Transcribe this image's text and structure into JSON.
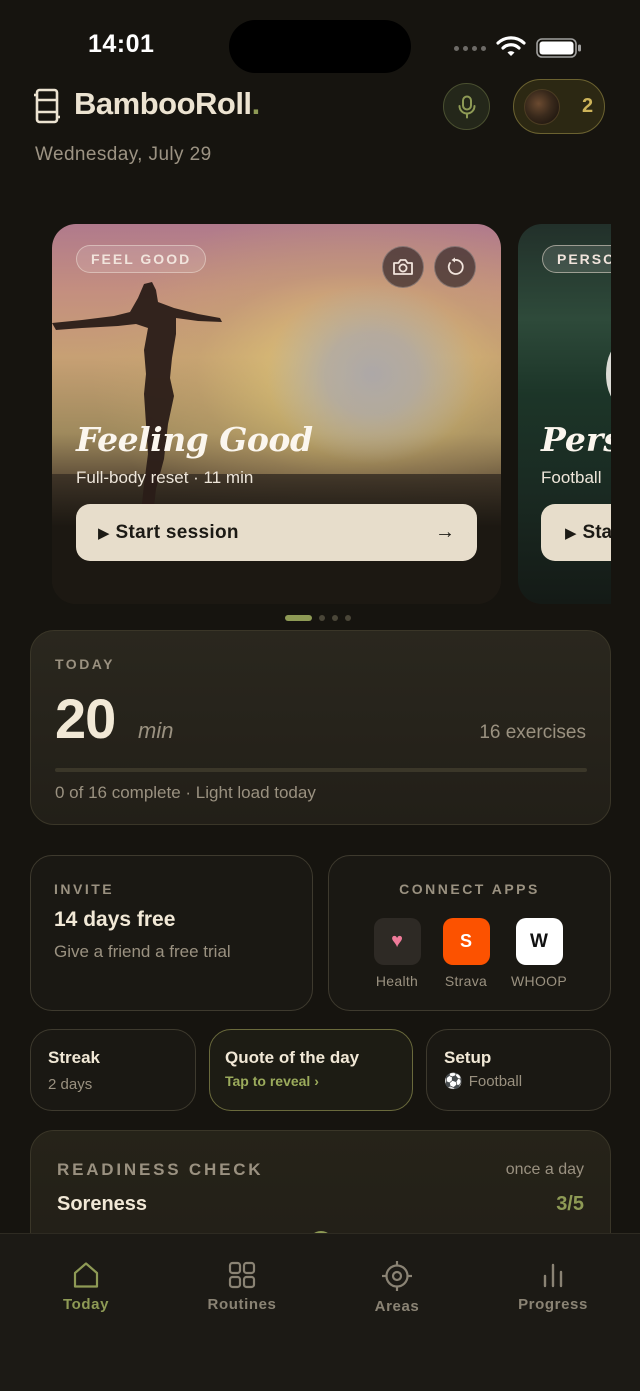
{
  "status_bar": {
    "time": "14:01"
  },
  "header": {
    "app_name": "BambooRoll",
    "app_name_dot": ".",
    "date": "Wednesday, July 29",
    "profile_count": "2"
  },
  "hero_cards": [
    {
      "badge": "FEEL GOOD",
      "title": "Feeling Good",
      "subtitle": "Full-body reset · 11 min",
      "play_glyph": "▶",
      "button_label": "Start session",
      "button_arrow": "→"
    },
    {
      "badge": "PERSO",
      "title": "Pers",
      "subtitle": "Football",
      "play_glyph": "▶",
      "button_label": "Sta"
    }
  ],
  "pager": {
    "count": 4,
    "active_index": 0
  },
  "today": {
    "label": "TODAY",
    "value": "20",
    "unit": "min",
    "exercises": "16 exercises",
    "status": "0 of 16 complete · Light load today",
    "progress": 0
  },
  "invite": {
    "label": "INVITE",
    "title": "14 days free",
    "description": "Give a friend a free trial"
  },
  "connect_apps": {
    "label": "CONNECT APPS",
    "apps": [
      {
        "name": "Health",
        "glyph": "♥"
      },
      {
        "name": "Strava",
        "glyph": "S"
      },
      {
        "name": "WHOOP",
        "glyph": "W"
      }
    ]
  },
  "streak": {
    "title": "Streak",
    "value": "2 days"
  },
  "quote": {
    "title": "Quote of the day",
    "action": "Tap to reveal ›"
  },
  "setup": {
    "title": "Setup",
    "sport_icon": "⚽",
    "sport": "Football"
  },
  "readiness": {
    "label": "READINESS CHECK",
    "frequency": "once a day",
    "metric": "Soreness",
    "value": "3/5"
  },
  "tabs": [
    {
      "label": "Today",
      "icon": "home-icon",
      "active": true
    },
    {
      "label": "Routines",
      "icon": "grid-icon",
      "active": false
    },
    {
      "label": "Areas",
      "icon": "target-icon",
      "active": false
    },
    {
      "label": "Progress",
      "icon": "bar-chart-icon",
      "active": false
    }
  ],
  "colors": {
    "accent": "#8e9a55",
    "background": "#16140f",
    "gold": "#cdb45a",
    "strava": "#fc5200"
  }
}
